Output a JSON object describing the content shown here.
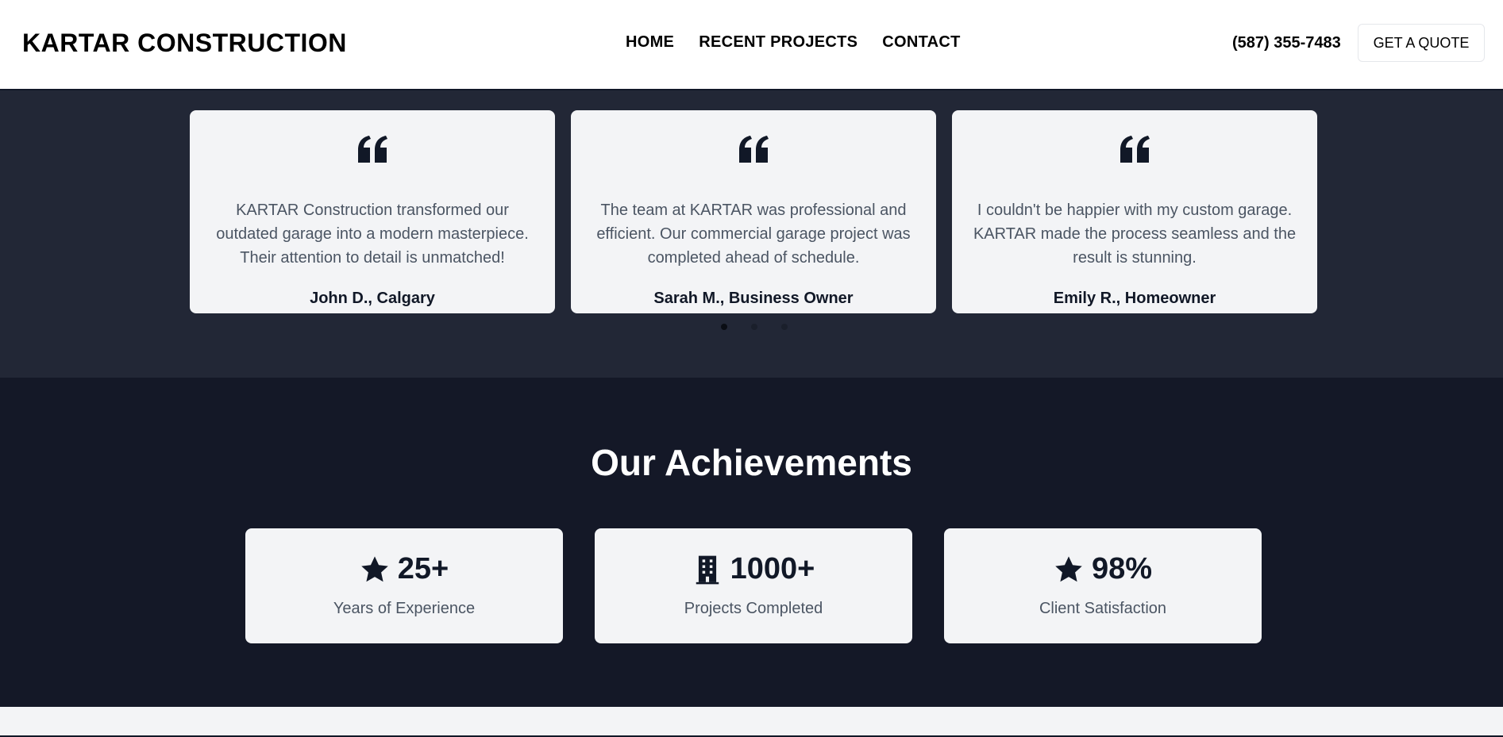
{
  "header": {
    "brand": "KARTAR CONSTRUCTION",
    "nav": [
      "HOME",
      "RECENT PROJECTS",
      "CONTACT"
    ],
    "phone": "(587) 355-7483",
    "cta": "GET A QUOTE"
  },
  "testimonials": {
    "items": [
      {
        "text": "KARTAR Construction transformed our outdated garage into a modern masterpiece. Their attention to detail is unmatched!",
        "author": "John D., Calgary",
        "icon": "quote-icon"
      },
      {
        "text": "The team at KARTAR was professional and efficient. Our commercial garage project was completed ahead of schedule.",
        "author": "Sarah M., Business Owner",
        "icon": "quote-icon"
      },
      {
        "text": "I couldn't be happier with my custom garage. KARTAR made the process seamless and the result is stunning.",
        "author": "Emily R., Homeowner",
        "icon": "quote-icon"
      }
    ],
    "active_slide": 1,
    "slide_count": 3
  },
  "achievements": {
    "title": "Our Achievements",
    "items": [
      {
        "icon": "star-icon",
        "value": "25+",
        "label": "Years of Experience"
      },
      {
        "icon": "building-icon",
        "value": "1000+",
        "label": "Projects Completed"
      },
      {
        "icon": "star-icon",
        "value": "98%",
        "label": "Client Satisfaction"
      }
    ]
  },
  "colors": {
    "header_bg": "#ffffff",
    "testimonials_bg": "#222736",
    "achievements_bg": "#141827",
    "card_bg": "#f3f4f6",
    "text_dark": "#111827",
    "text_muted": "#4b5563"
  }
}
